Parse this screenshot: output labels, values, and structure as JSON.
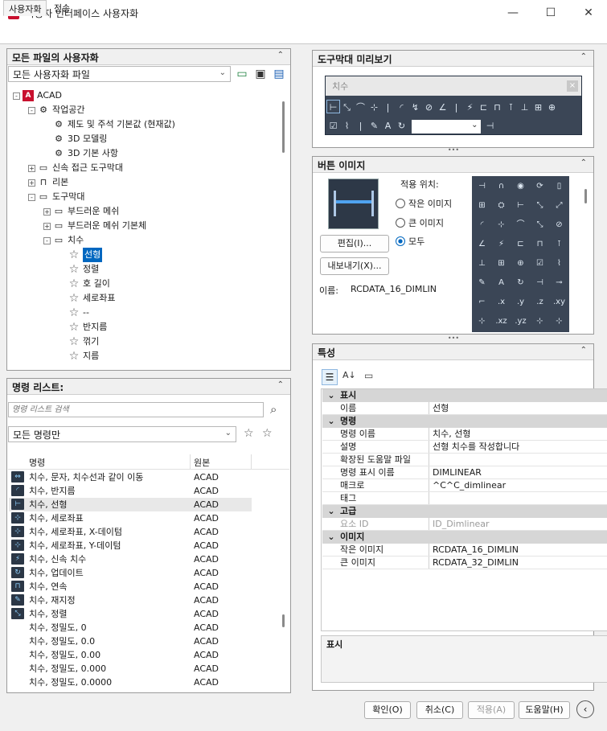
{
  "window": {
    "title": "사용자 인터페이스 사용자화",
    "app_icon": "A",
    "controls": [
      "minimize",
      "maximize",
      "close"
    ]
  },
  "tabs": [
    {
      "label": "사용자화",
      "active": true
    },
    {
      "label": "전송",
      "active": false
    }
  ],
  "customize_panel": {
    "header": "모든 파일의 사용자화",
    "dropdown_value": "모든 사용자화 파일",
    "tree": [
      {
        "label": "ACAD",
        "level": 0,
        "icon": "acad-icon",
        "expander": "-"
      },
      {
        "label": "작업공간",
        "level": 1,
        "icon": "gear-icon",
        "expander": "-"
      },
      {
        "label": "제도 및 주석 기본값 (현재값)",
        "level": 2,
        "icon": "gear-icon",
        "expander": ""
      },
      {
        "label": "3D 모델링",
        "level": 2,
        "icon": "gear-icon",
        "expander": ""
      },
      {
        "label": "3D 기본 사항",
        "level": 2,
        "icon": "gear-icon",
        "expander": ""
      },
      {
        "label": "신속 접근 도구막대",
        "level": 1,
        "icon": "toolbar-icon",
        "expander": "+"
      },
      {
        "label": "리본",
        "level": 1,
        "icon": "ribbon-icon",
        "expander": "+"
      },
      {
        "label": "도구막대",
        "level": 1,
        "icon": "toolbar-icon",
        "expander": "-"
      },
      {
        "label": "부드러운 메쉬",
        "level": 2,
        "icon": "toolbar-icon",
        "expander": "+"
      },
      {
        "label": "부드러운 메쉬 기본체",
        "level": 2,
        "icon": "toolbar-icon",
        "expander": "+"
      },
      {
        "label": "치수",
        "level": 2,
        "icon": "toolbar-icon",
        "expander": "-"
      },
      {
        "label": "선형",
        "level": 3,
        "icon": "star-icon",
        "expander": "",
        "selected": true
      },
      {
        "label": "정렬",
        "level": 3,
        "icon": "star-icon",
        "expander": ""
      },
      {
        "label": "호 길이",
        "level": 3,
        "icon": "star-icon",
        "expander": ""
      },
      {
        "label": "세로좌표",
        "level": 3,
        "icon": "star-icon",
        "expander": ""
      },
      {
        "label": "--",
        "level": 3,
        "icon": "star-icon",
        "expander": ""
      },
      {
        "label": "반지름",
        "level": 3,
        "icon": "star-icon",
        "expander": ""
      },
      {
        "label": "꺾기",
        "level": 3,
        "icon": "star-icon",
        "expander": ""
      },
      {
        "label": "지름",
        "level": 3,
        "icon": "star-icon",
        "expander": ""
      }
    ]
  },
  "command_panel": {
    "header": "명령 리스트:",
    "search_placeholder": "명령 리스트 검색",
    "filter_value": "모든 명령만",
    "col_name": "명령",
    "col_source": "원본",
    "commands": [
      {
        "name": "치수, 문자, 치수선과 같이 이동",
        "source": "ACAD"
      },
      {
        "name": "치수, 반지름",
        "source": "ACAD"
      },
      {
        "name": "치수, 선형",
        "source": "ACAD",
        "selected": true
      },
      {
        "name": "치수, 세로좌표",
        "source": "ACAD"
      },
      {
        "name": "치수, 세로좌표, X-데이텀",
        "source": "ACAD"
      },
      {
        "name": "치수, 세로좌표, Y-데이텀",
        "source": "ACAD"
      },
      {
        "name": "치수, 신속 치수",
        "source": "ACAD"
      },
      {
        "name": "치수, 업데이트",
        "source": "ACAD"
      },
      {
        "name": "치수, 연속",
        "source": "ACAD"
      },
      {
        "name": "치수, 재지정",
        "source": "ACAD"
      },
      {
        "name": "치수, 정렬",
        "source": "ACAD"
      },
      {
        "name": "치수, 정밀도, 0",
        "source": "ACAD"
      },
      {
        "name": "치수, 정밀도, 0.0",
        "source": "ACAD"
      },
      {
        "name": "치수, 정밀도, 0.00",
        "source": "ACAD"
      },
      {
        "name": "치수, 정밀도, 0.000",
        "source": "ACAD"
      },
      {
        "name": "치수, 정밀도, 0.0000",
        "source": "ACAD"
      }
    ]
  },
  "toolbar_preview": {
    "header": "도구막대 미리보기",
    "toolbar_title": "치수",
    "close_glyph": "×"
  },
  "button_image": {
    "header": "버튼 이미지",
    "apply_label": "적용 위치:",
    "options": [
      "작은 이미지",
      "큰 이미지",
      "모두"
    ],
    "selected_option": "모두",
    "edit_button": "편집(I)...",
    "export_button": "내보내기(X)...",
    "name_label": "이름:",
    "name_value": "RCDATA_16_DIMLIN",
    "grid_glyphs": [
      ".x",
      ".y",
      ".z",
      ".xy",
      ".xz",
      ".yz"
    ]
  },
  "properties": {
    "header": "특성",
    "sections": [
      {
        "title": "표시",
        "rows": [
          {
            "key": "이름",
            "value": "선형"
          }
        ]
      },
      {
        "title": "명령",
        "rows": [
          {
            "key": "명령 이름",
            "value": "치수, 선형"
          },
          {
            "key": "설명",
            "value": "선형 치수를 작성합니다"
          },
          {
            "key": "확장된 도움말 파일",
            "value": ""
          },
          {
            "key": "명령 표시 이름",
            "value": "DIMLINEAR"
          },
          {
            "key": "매크로",
            "value": "^C^C_dimlinear"
          },
          {
            "key": "태그",
            "value": ""
          }
        ]
      },
      {
        "title": "고급",
        "rows": [
          {
            "key": "요소 ID",
            "value": "ID_Dimlinear",
            "disabled": true
          }
        ]
      },
      {
        "title": "이미지",
        "rows": [
          {
            "key": "작은 이미지",
            "value": "RCDATA_16_DIMLIN"
          },
          {
            "key": "큰 이미지",
            "value": "RCDATA_32_DIMLIN"
          }
        ]
      }
    ],
    "description_title": "표시"
  },
  "footer": {
    "ok": "확인(O)",
    "cancel": "취소(C)",
    "apply": "적용(A)",
    "help": "도움말(H)"
  },
  "colors": {
    "accent": "#0067c0",
    "selection": "#cce4f7",
    "toolbar_bg": "#2e3a4a",
    "acad_red": "#c8102e"
  }
}
